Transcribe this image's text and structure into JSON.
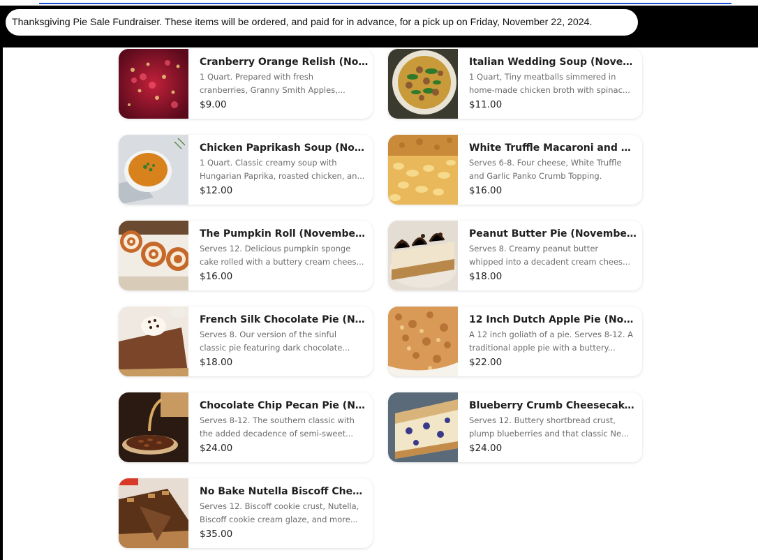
{
  "banner": {
    "text": "Thanksgiving Pie Sale Fundraiser. These items will be ordered, and paid for in advance, for a pick up on Friday, November 22, 2024."
  },
  "items": [
    {
      "title": "Cranberry Orange Relish (Nov...",
      "desc1": "1 Quart. Prepared with fresh",
      "desc2": "cranberries, Granny Smith Apples,...",
      "price": "$9.00",
      "image": "cranberry-relish-photo"
    },
    {
      "title": "Italian Wedding Soup (Novem...",
      "desc1": "1 Quart, Tiny meatballs simmered in",
      "desc2": "home-made chicken broth with spinac...",
      "price": "$11.00",
      "image": "wedding-soup-photo"
    },
    {
      "title": "Chicken Paprikash Soup (Nove...",
      "desc1": "1 Quart. Classic creamy soup with",
      "desc2": "Hungarian Paprika, roasted chicken, an...",
      "price": "$12.00",
      "image": "paprikash-soup-photo"
    },
    {
      "title": "White Truffle Macaroni and Ch...",
      "desc1": "Serves 6-8. Four cheese, White Truffle",
      "desc2": "and Garlic Panko Crumb Topping.",
      "price": "$16.00",
      "image": "truffle-mac-photo"
    },
    {
      "title": "The Pumpkin Roll (November ...",
      "desc1": "Serves 12. Delicious pumpkin sponge",
      "desc2": "cake rolled with a buttery cream chees...",
      "price": "$16.00",
      "image": "pumpkin-roll-photo"
    },
    {
      "title": "Peanut Butter Pie (November ...",
      "desc1": "Serves 8. Creamy peanut butter",
      "desc2": "whipped into a decadent cream chees...",
      "price": "$18.00",
      "image": "peanut-butter-pie-photo"
    },
    {
      "title": "French Silk Chocolate Pie (Nov...",
      "desc1": "Serves 8. Our version of the sinful",
      "desc2": "classic pie featuring dark chocolate...",
      "price": "$18.00",
      "image": "french-silk-pie-photo"
    },
    {
      "title": "12 Inch Dutch Apple Pie (Nove...",
      "desc1": "A 12 inch goliath of a pie. Serves 8-12. A",
      "desc2": "traditional apple pie with a buttery...",
      "price": "$22.00",
      "image": "dutch-apple-pie-photo"
    },
    {
      "title": "Chocolate Chip Pecan Pie (Nov...",
      "desc1": "Serves 8-12. The southern classic with",
      "desc2": "the added decadence of semi-sweet...",
      "price": "$24.00",
      "image": "pecan-pie-photo"
    },
    {
      "title": "Blueberry Crumb Cheesecake ...",
      "desc1": "Serves 12. Buttery shortbread crust,",
      "desc2": "plump blueberries and that classic Ne...",
      "price": "$24.00",
      "image": "blueberry-cheesecake-photo"
    },
    {
      "title": "No Bake Nutella Biscoff Chees...",
      "desc1": "Serves 12. Biscoff cookie crust, Nutella,",
      "desc2": "Biscoff cookie cream glaze, and more...",
      "price": "$35.00",
      "image": "nutella-biscoff-photo"
    }
  ]
}
